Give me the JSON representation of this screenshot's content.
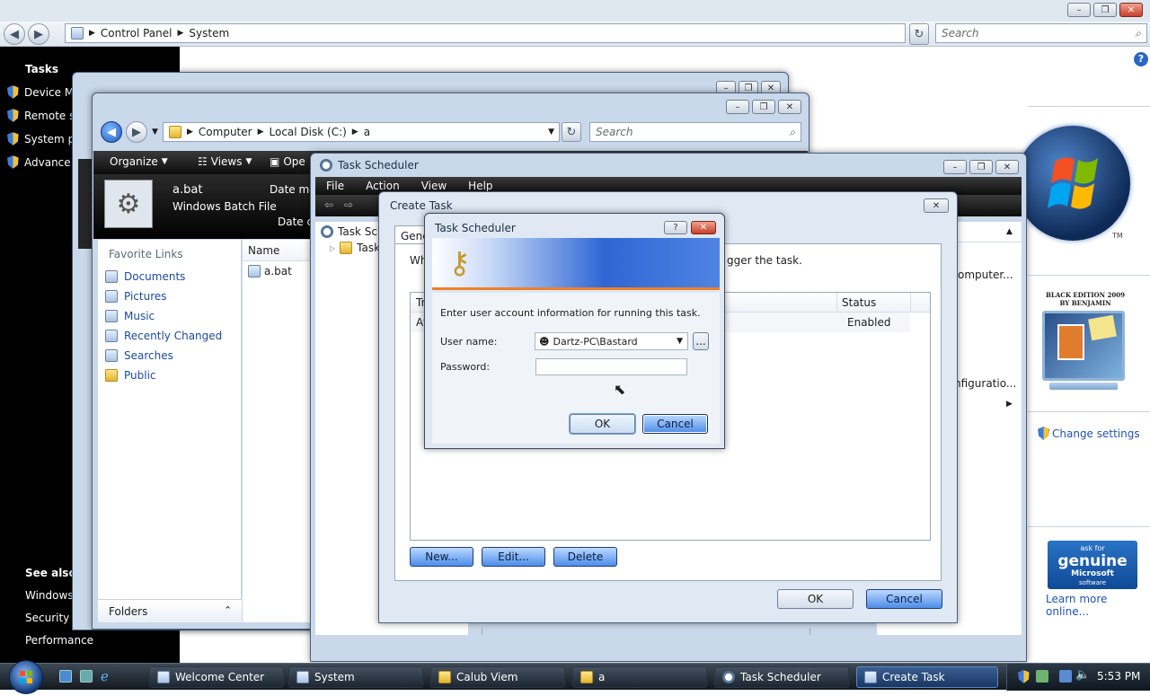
{
  "control_panel": {
    "breadcrumb": [
      "Control Panel",
      "System"
    ],
    "search_placeholder": "Search",
    "left_title": "Tasks",
    "tasks": [
      "Device Ma",
      "Remote s",
      "System pr",
      "Advance"
    ],
    "see_also_title": "See also",
    "see_also": [
      "Windows",
      "Security Cente",
      "Performance"
    ],
    "change_settings": "Change settings",
    "genuine": {
      "line1": "ask for",
      "line2": "genuine",
      "line3": "Microsoft",
      "line4": "software"
    },
    "learn_more": "Learn more online...",
    "oem": {
      "line1": "BLACK EDITION 2009",
      "line2": "BY BENJAMIN"
    },
    "tm": "TM"
  },
  "explorer": {
    "breadcrumb": [
      "Computer",
      "Local Disk (C:)",
      "a"
    ],
    "search_placeholder": "Search",
    "toolbar": {
      "organize": "Organize",
      "views": "Views",
      "open": "Ope"
    },
    "preview": {
      "name": "a.bat",
      "type": "Windows Batch File",
      "date_modified": "Date mo",
      "date_created": "Date cr"
    },
    "favorite_links_title": "Favorite Links",
    "links": [
      "Documents",
      "Pictures",
      "Music",
      "Recently Changed",
      "Searches",
      "Public"
    ],
    "folders_label": "Folders",
    "column_name": "Name",
    "files": [
      "a.bat"
    ]
  },
  "task_scheduler": {
    "title": "Task Scheduler",
    "menu": [
      "File",
      "Action",
      "View",
      "Help"
    ],
    "tree": [
      "Task Sch",
      "Task"
    ],
    "right_pane": [
      "omputer...",
      "nfiguratio..."
    ]
  },
  "create_task": {
    "title": "Create Task",
    "tab": "Gene",
    "description": "Wh",
    "description_tail": "gger the task.",
    "table": {
      "headers": [
        "Tr",
        "Status"
      ],
      "rows": [
        {
          "trigger": "At",
          "status": "Enabled"
        }
      ]
    },
    "buttons": {
      "new": "New...",
      "edit": "Edit...",
      "delete": "Delete",
      "ok": "OK",
      "cancel": "Cancel"
    }
  },
  "credentials_dialog": {
    "title": "Task Scheduler",
    "help": "?",
    "message": "Enter user account information for running this task.",
    "username_label": "User name:",
    "username_value": "Dartz-PC\\Bastard",
    "password_label": "Password:",
    "password_value": "",
    "browse_label": "...",
    "ok": "OK",
    "cancel": "Cancel"
  },
  "taskbar": {
    "items": [
      "Welcome Center",
      "System",
      "Calub Viem",
      "a",
      "Task Scheduler",
      "Create Task"
    ],
    "active_item": "Create Task",
    "time": "5:53 PM"
  },
  "colors": {
    "accent": "#4d8de8",
    "black_panel": "#000000",
    "taskbar": "#1b2430"
  }
}
